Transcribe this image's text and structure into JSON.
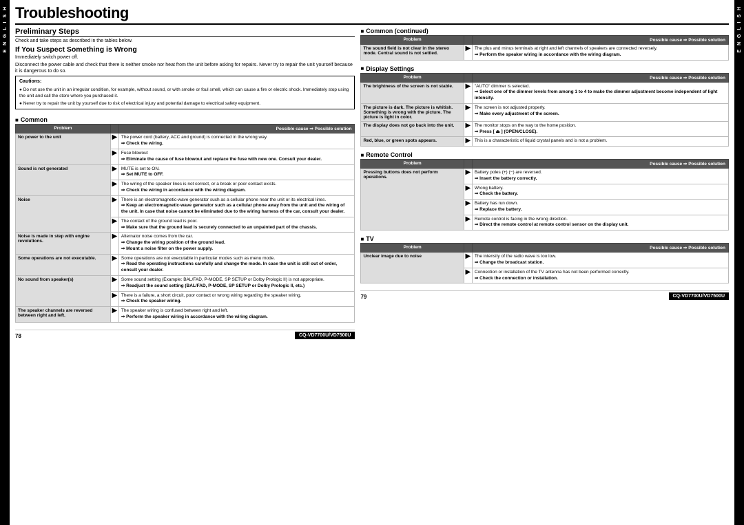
{
  "page": {
    "title": "Troubleshooting",
    "left_page_number": "78",
    "right_page_number": "79",
    "model_number": "CQ-VD7700U/VD7500U",
    "side_tab": "ENGLISH"
  },
  "preliminary": {
    "title": "Preliminary Steps",
    "intro": "Check and take steps as described in the tables below.",
    "suspect_title": "If You Suspect Something is Wrong",
    "suspect_text1": "Immediately switch power off.",
    "suspect_text2": "Disconnect the power cable and check that there is neither smoke nor heat from the unit before asking for repairs. Never try to repair the unit yourself because it is dangerous to do so."
  },
  "cautions": {
    "title": "Cautions:",
    "items": [
      "Do not use the unit in an irregular condition, for example, without sound, or with smoke or foul smell, which can cause a fire or electric shock. Immediately stop using the unit and call the store where you purchased it.",
      "Never try to repair the unit by yourself due to risk of electrical injury and potential damage to electrical safety equipment."
    ]
  },
  "common_section": {
    "title": "Common",
    "header_problem": "Problem",
    "header_possible": "Possible cause",
    "header_solution": "Possible solution",
    "rows": [
      {
        "problem": "No power to the unit",
        "solutions": [
          {
            "cause": "The power cord (battery, ACC and ground) is connected in the wrong way.",
            "bold": "⇒ Check the wiring."
          },
          {
            "cause": "Fuse blowout",
            "bold": "⇒ Eliminate the cause of fuse blowout and replace the fuse with new one. Consult your dealer."
          }
        ]
      },
      {
        "problem": "Sound is not generated",
        "solutions": [
          {
            "cause": "MUTE is set to ON.",
            "bold": "⇒ Set MUTE to OFF."
          },
          {
            "cause": "The wiring of the speaker lines is not correct, or a break or poor contact exists.",
            "bold": "⇒ Check the wiring in accordance with the wiring diagram."
          }
        ]
      },
      {
        "problem": "Noise",
        "solutions": [
          {
            "cause": "There is an electromagnetic-wave generator such as a cellular phone near the unit or its electrical lines.",
            "bold": "⇒ Keep an electromagnetic-wave generator such as a cellular phone away from the unit and the wiring of the unit. In case that noise cannot be eliminated due to the wiring harness of the car, consult your dealer."
          },
          {
            "cause": "The contact of the ground lead is poor.",
            "bold": "⇒ Make sure that the ground lead is  securely connected to an unpainted part of the chassis."
          }
        ]
      },
      {
        "problem": "Noise is made in step with engine revolutions.",
        "solutions": [
          {
            "cause": "Alternator noise comes from the car.",
            "bold": "⇒ Change the wiring position of the ground lead.\n⇒ Mount a noise filter on the power supply."
          }
        ]
      },
      {
        "problem": "Some operations are not executable.",
        "solutions": [
          {
            "cause": "Some operations are not executable in particular modes such as menu mode.",
            "bold": "⇒ Read the operating instructions carefully and change the mode. In case the unit is still out of order, consult your dealer."
          }
        ]
      },
      {
        "problem": "No sound from speaker(s)",
        "solutions": [
          {
            "cause": "Some sound setting (Example: BAL/FAD, P-MODE, SP SETUP or Dolby Prologic II) is not appropriate.",
            "bold": "⇒ Readjust the sound setting (BAL/FAD, P-MODE, SP SETUP or Dolby Prologic II, etc.)"
          },
          {
            "cause": "There is a failure, a short circuit, poor contact or wrong wiring regarding the speaker wiring.",
            "bold": "⇒ Check the speaker wiring."
          }
        ]
      },
      {
        "problem": "The speaker channels are reversed between right and left.",
        "solutions": [
          {
            "cause": "The speaker wiring is confused between right and left.",
            "bold": "⇒ Perform the speaker wiring in accordance with the wiring diagram."
          }
        ]
      }
    ]
  },
  "common_continued": {
    "title": "Common (continued)",
    "rows": [
      {
        "problem": "The sound field is not clear in the stereo mode. Central sound is not settled.",
        "solutions": [
          {
            "cause": "The plus and minus terminals at right and left channels of speakers are connected reversely.",
            "bold": "⇒ Perform the speaker wiring in accordance with the wiring diagram."
          }
        ]
      }
    ]
  },
  "display_settings": {
    "title": "Display Settings",
    "rows": [
      {
        "problem": "The brightness of the screen is not stable.",
        "solutions": [
          {
            "cause": "\"AUTO\" dimmer is selected.",
            "bold": "⇒ Select one of the dimmer levels from among 1 to 4 to make the dimmer adjustment become independent of light intensity."
          }
        ]
      },
      {
        "problem": "The picture is dark. The picture is whitish. Something is wrong with the picture. The picture is light in color.",
        "solutions": [
          {
            "cause": "The screen is not adjusted properly.",
            "bold": "⇒ Make every adjustment of the screen."
          }
        ]
      },
      {
        "problem": "The display does not go back into the unit.",
        "solutions": [
          {
            "cause": "The monitor stops on the way to the home position.",
            "bold": "⇒ Press [ ⏏ ] (OPEN/CLOSE)."
          }
        ]
      },
      {
        "problem": "Red, blue, or green spots appears.",
        "solutions": [
          {
            "cause": "This is a characteristic of liquid crystal panels and is not a problem.",
            "bold": ""
          }
        ]
      }
    ]
  },
  "remote_control": {
    "title": "Remote Control",
    "rows": [
      {
        "problem": "Pressing buttons does not perform operations.",
        "solutions": [
          {
            "cause": "Battery poles (+) (−) are reversed.",
            "bold": "⇒ Insert the battery correctly."
          },
          {
            "cause": "Wrong battery.",
            "bold": "⇒ Check the battery."
          },
          {
            "cause": "Battery has run down.",
            "bold": "⇒ Replace the battery."
          },
          {
            "cause": "Remote control is facing in the wrong direction.",
            "bold": "⇒ Direct the remote control at remote control sensor on the display unit."
          }
        ]
      }
    ]
  },
  "tv_section": {
    "title": "TV",
    "rows": [
      {
        "problem": "Unclear image due to noise",
        "solutions": [
          {
            "cause": "The intensity of the radio wave is too low.",
            "bold": "⇒ Change the broadcast station."
          },
          {
            "cause": "Connection or installation of the TV antenna has not been performed correctly.",
            "bold": "⇒ Check the connection or installation."
          }
        ]
      }
    ]
  }
}
